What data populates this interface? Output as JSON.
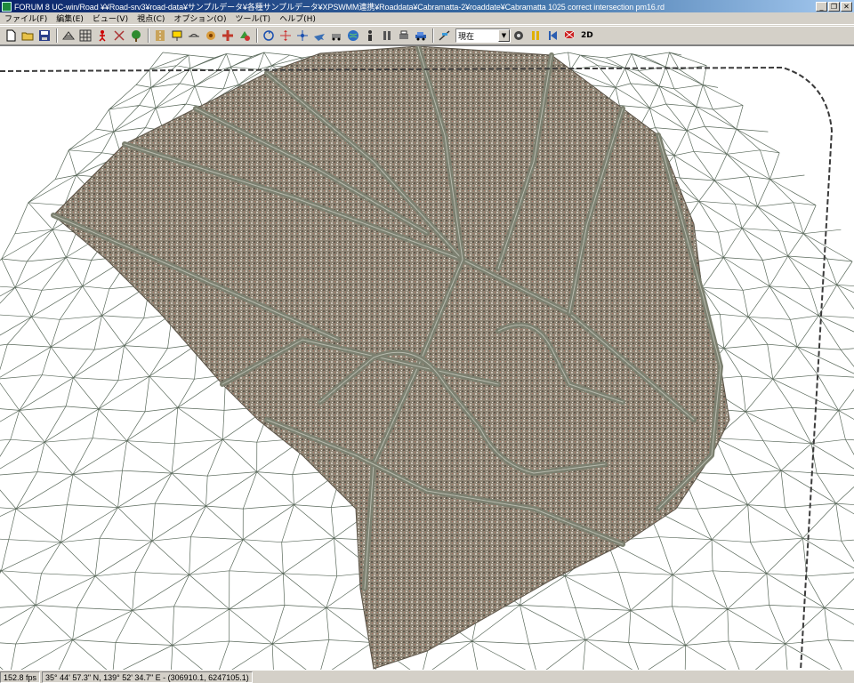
{
  "window": {
    "title": "FORUM 8   UC-win/Road    ¥¥Road-srv3¥road-data¥サンプルデータ¥各種サンプルデータ¥XPSWMM連携¥Roaddata¥Cabramatta-2¥roaddate¥Cabramatta 1025 correct intersection pm16.rd",
    "minimize": "_",
    "maximize": "❐",
    "close": "✕"
  },
  "menu": [
    "ファイル(F)",
    "編集(E)",
    "ビュー(V)",
    "視点(C)",
    "オプション(O)",
    "ツール(T)",
    "ヘルプ(H)"
  ],
  "toolbar": {
    "time_select": "現在",
    "mode_2d": "2D"
  },
  "status": {
    "fps": "152.8 fps",
    "coords": "35°  44' 57.3\" N, 139°  52' 34.7\" E  -  (306910.1, 6247105.1)"
  },
  "colors": {
    "titlebar": "#0a246a",
    "mesh": "#5b6a5c",
    "road": "#7c8070",
    "terrain": "#8e8474"
  }
}
